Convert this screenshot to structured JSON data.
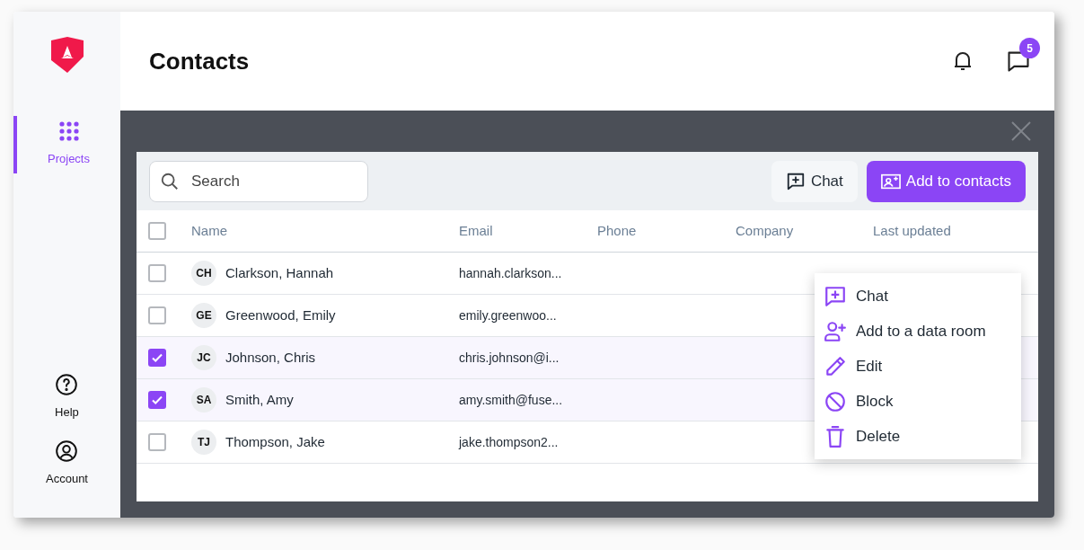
{
  "sidebar": {
    "items": [
      {
        "label": "Projects",
        "kind": "grid",
        "selected": true
      }
    ],
    "bottom_items": [
      {
        "label": "Help",
        "kind": "help"
      },
      {
        "label": "Account",
        "kind": "account"
      }
    ]
  },
  "header": {
    "title": "Contacts",
    "chat_badge": "5"
  },
  "toolbar": {
    "search": {
      "placeholder": "Search"
    },
    "buttons": [
      {
        "label": "Chat",
        "kind": "secondary"
      },
      {
        "label": "Add to contacts",
        "kind": "primary"
      }
    ]
  },
  "table": {
    "select_all": {
      "checked": false
    },
    "columns": [
      "Name",
      "Email",
      "Phone",
      "Company",
      "Last updated"
    ],
    "rows": [
      {
        "checked": false,
        "initials": "CH",
        "name": "Clarkson, Hannah",
        "email": "hannah.clarkson..."
      },
      {
        "checked": false,
        "initials": "GE",
        "name": "Greenwood, Emily",
        "email": "emily.greenwoo..."
      },
      {
        "checked": true,
        "initials": "JC",
        "name": "Johnson, Chris",
        "email": "chris.johnson@i..."
      },
      {
        "checked": true,
        "initials": "SA",
        "name": "Smith, Amy",
        "email": "amy.smith@fuse..."
      },
      {
        "checked": false,
        "initials": "TJ",
        "name": "Thompson, Jake",
        "email": "jake.thompson2..."
      }
    ]
  },
  "context_menu": {
    "items": [
      {
        "label": "Chat",
        "kind": "chat"
      },
      {
        "label": "Add to a data room",
        "kind": "user-plus"
      },
      {
        "label": "Edit",
        "kind": "pencil"
      },
      {
        "label": "Block",
        "kind": "block"
      },
      {
        "label": "Delete",
        "kind": "trash"
      }
    ]
  }
}
